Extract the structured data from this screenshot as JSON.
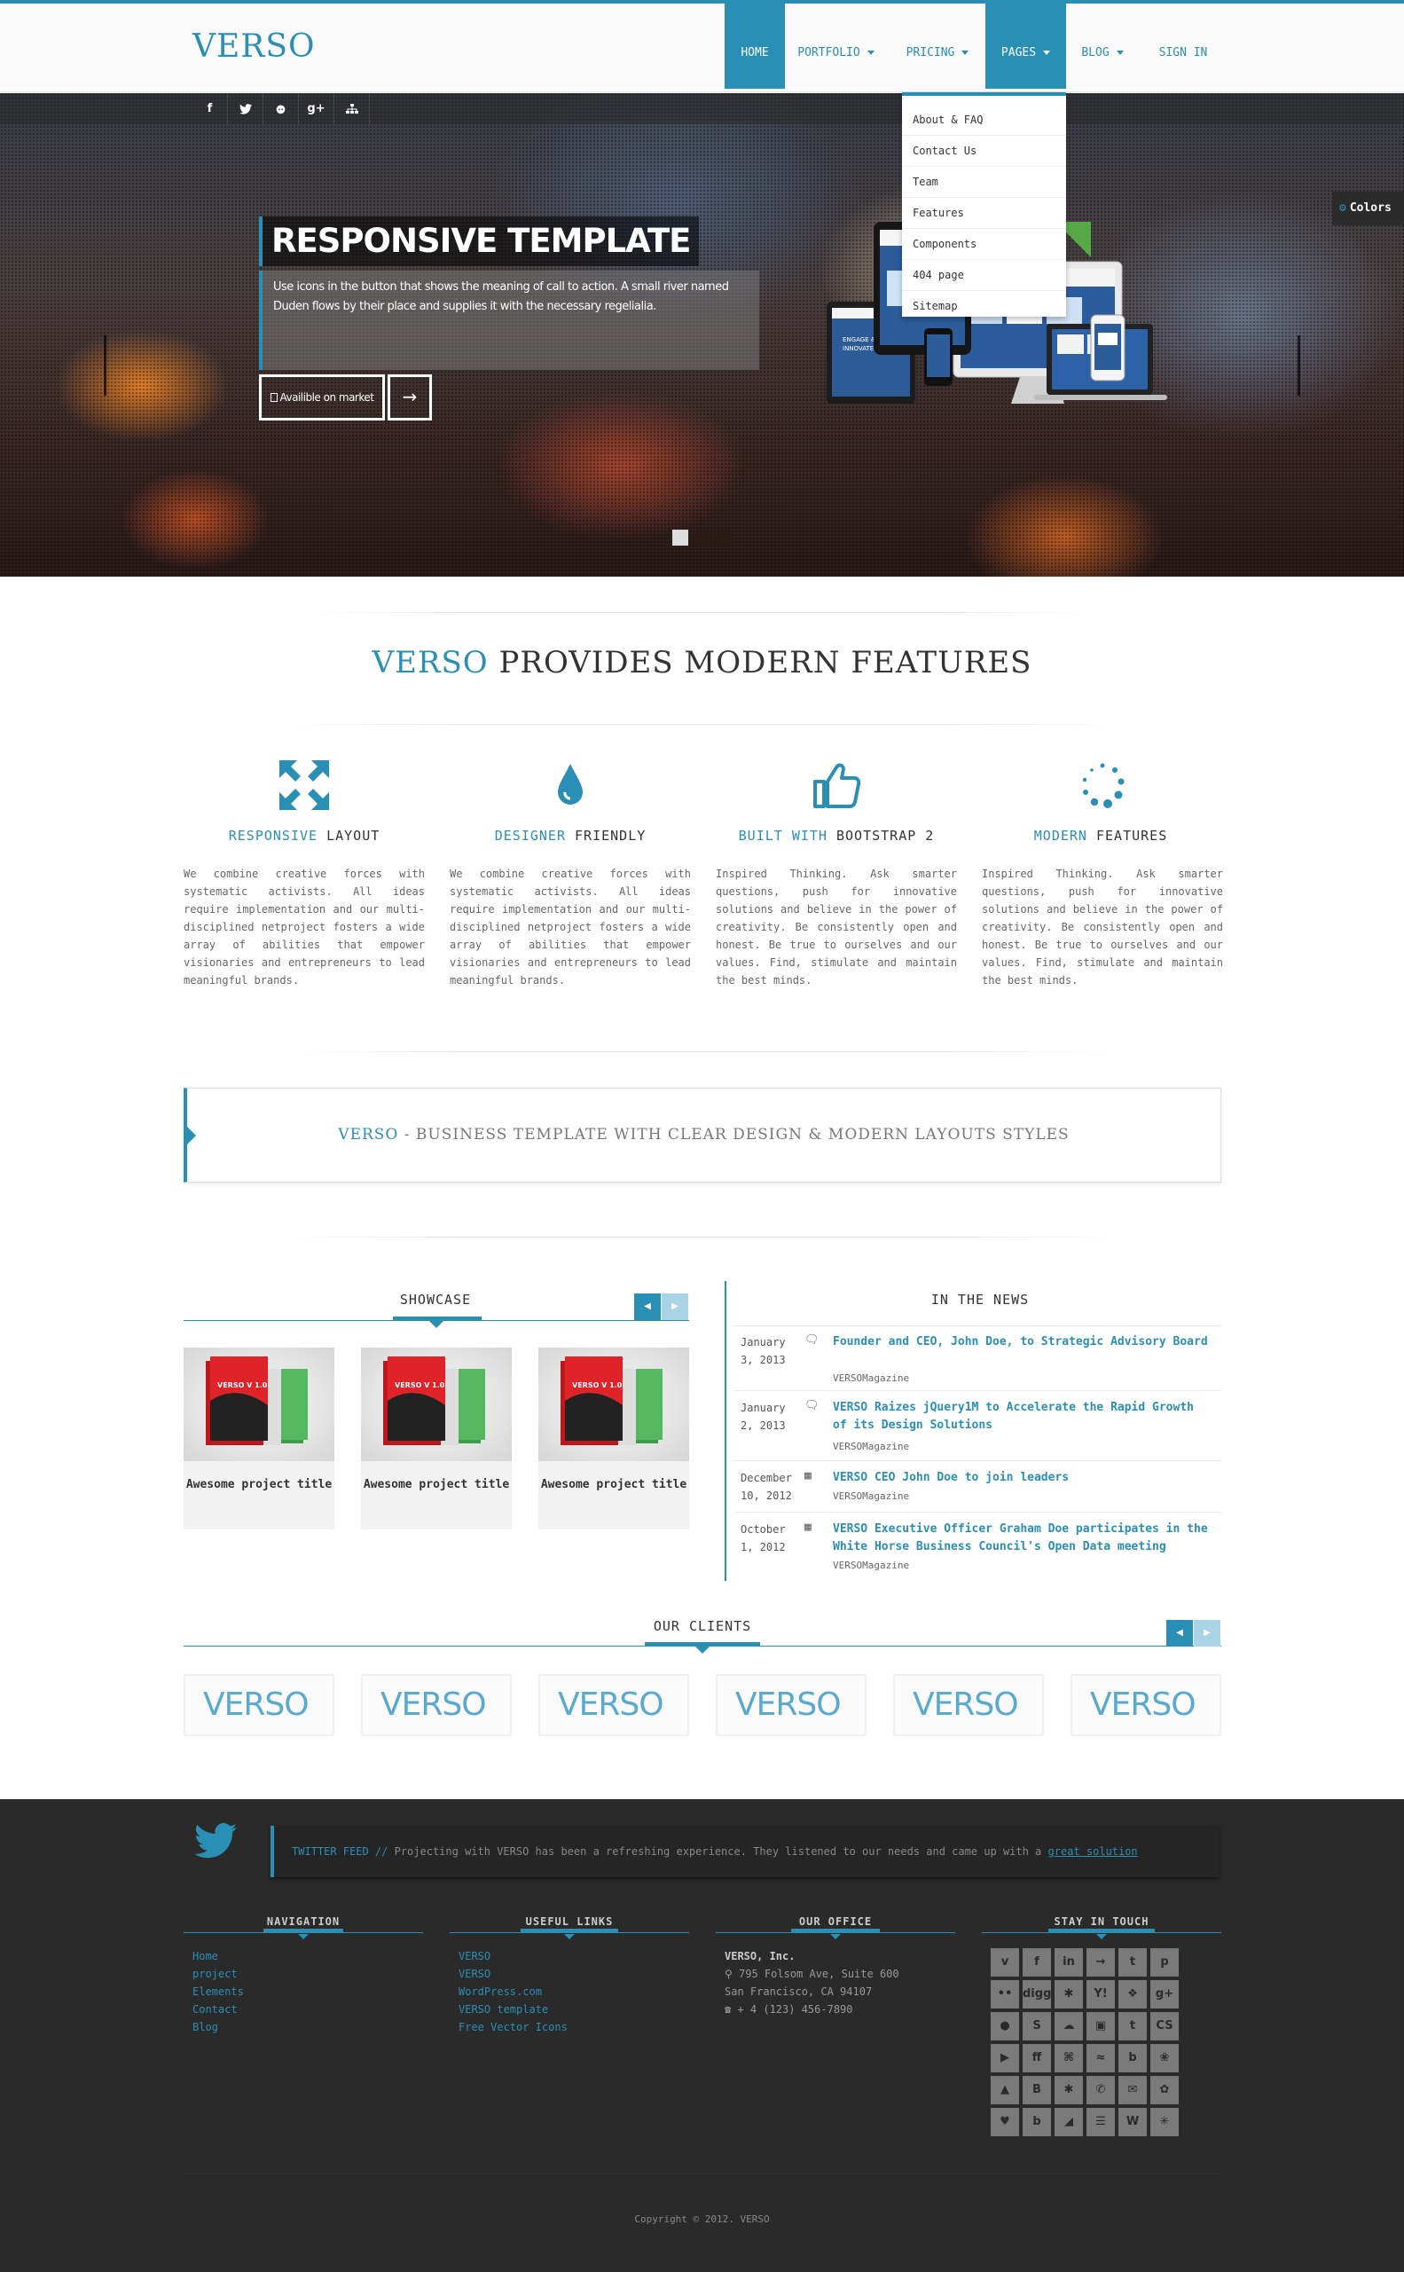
{
  "header": {
    "logo": "VERSO",
    "nav": [
      {
        "label": "HOME",
        "active": true,
        "dropdown": false
      },
      {
        "label": "PORTFOLIO",
        "active": false,
        "dropdown": true
      },
      {
        "label": "PRICING",
        "active": false,
        "dropdown": true
      },
      {
        "label": "PAGES",
        "active": false,
        "dropdown": true
      },
      {
        "label": "BLOG",
        "active": false,
        "dropdown": true
      },
      {
        "label": "SIGN IN",
        "active": false,
        "dropdown": false
      }
    ],
    "pages_dropdown": [
      "About & FAQ",
      "Contact Us",
      "Team",
      "Features",
      "Components",
      "404 page",
      "Sitemap"
    ]
  },
  "social_strip": [
    "f",
    "twitter-icon",
    "github-icon",
    "g+",
    "sitemap-icon"
  ],
  "colors_button": {
    "label": "Colors",
    "icon": "gears-icon"
  },
  "hero": {
    "title": "RESPONSIVE TEMPLATE",
    "text": "Use icons in the button that shows the meaning of call to action. A small river named Duden flows by their place and supplies it with the necessary regelialia.",
    "button_label": "Availible on market",
    "arrow": "→",
    "slides": 3,
    "active_slide": 0
  },
  "features": {
    "title_highlight": "VERSO",
    "title_rest": " PROVIDES MODERN FEATURES",
    "items": [
      {
        "icon": "expand-arrows-icon",
        "title_hl": "RESPONSIVE",
        "title_rest": " LAYOUT",
        "text": "We combine creative forces with systematic activists. All ideas require implementation and our multi-disciplined netproject fosters a wide array of abilities that empower visionaries and entrepreneurs to lead meaningful brands."
      },
      {
        "icon": "droplet-icon",
        "title_hl": "DESIGNER",
        "title_rest": " FRIENDLY",
        "text": "We combine creative forces with systematic activists. All ideas require implementation and our multi-disciplined netproject fosters a wide array of abilities that empower visionaries and entrepreneurs to lead meaningful brands."
      },
      {
        "icon": "thumbs-up-icon",
        "title_hl": "BUILT WITH",
        "title_rest": " BOOTSTRAP 2",
        "text": "Inspired Thinking. Ask smarter questions, push for innovative solutions and believe in the power of creativity. Be consistently open and honest. Be true to ourselves and our values. Find, stimulate and maintain the best minds."
      },
      {
        "icon": "spinner-icon",
        "title_hl": "MODERN",
        "title_rest": " FEATURES",
        "text": "Inspired Thinking. Ask smarter questions, push for innovative solutions and believe in the power of creativity. Be consistently open and honest. Be true to ourselves and our values. Find, stimulate and maintain the best minds."
      }
    ]
  },
  "banner": {
    "highlight": "VERSO",
    "rest": " - BUSINESS TEMPLATE WITH CLEAR DESIGN & MODERN LAYOUTS STYLES"
  },
  "showcase": {
    "title": "SHOWCASE",
    "items": [
      {
        "title": "Awesome project title",
        "box_label": "VERSO V 1.0"
      },
      {
        "title": "Awesome project title",
        "box_label": "VERSO V 1.0"
      },
      {
        "title": "Awesome project title",
        "box_label": "VERSO V 1.0"
      }
    ]
  },
  "news": {
    "title": "IN THE NEWS",
    "items": [
      {
        "date": "January 3, 2013",
        "icon": "comments-icon",
        "title": "Founder and CEO, John Doe, to Strategic Advisory Board",
        "source": "VERSOMagazine"
      },
      {
        "date": "January 2, 2013",
        "icon": "comments-icon",
        "title": "VERSO Raizes jQuery1M to Accelerate the Rapid Growth of its Design Solutions",
        "source": "VERSOMagazine"
      },
      {
        "date": "December 10, 2012",
        "icon": "calendar-icon",
        "title": "VERSO CEO John Doe to join leaders",
        "source": "VERSOMagazine"
      },
      {
        "date": "October 1, 2012",
        "icon": "calendar-icon",
        "title": "VERSO Executive Officer Graham Doe participates in the White Horse Business Council's Open Data meeting",
        "source": "VERSOMagazine"
      }
    ]
  },
  "clients": {
    "title": "OUR CLIENTS",
    "logos": [
      "VERSO",
      "VERSO",
      "VERSO",
      "VERSO",
      "VERSO",
      "VERSO"
    ]
  },
  "footer": {
    "twitter": {
      "label": "TWITTER FEED //",
      "text": " Projecting with VERSO has been a refreshing experience. They listened to our needs and came up with a ",
      "link": "great solution"
    },
    "navigation": {
      "title": "NAVIGATION",
      "links": [
        "Home",
        "project",
        "Elements",
        "Contact",
        "Blog"
      ]
    },
    "useful_links": {
      "title": "USEFUL LINKS",
      "links": [
        "VERSO",
        "VERSO",
        "WordPress.com",
        "VERSO template",
        "Free Vector Icons"
      ]
    },
    "office": {
      "title": "OUR OFFICE",
      "company": "VERSO, Inc.",
      "address1": "795 Folsom Ave, Suite 600",
      "address2": "San Francisco, CA 94107",
      "phone": "+ 4 (123) 456-7890"
    },
    "stay_in_touch": {
      "title": "STAY IN TOUCH",
      "icons": [
        "v",
        "f",
        "in",
        "→",
        "t",
        "p",
        "••",
        "digg",
        "✱",
        "Y!",
        "❖",
        "g+",
        "●",
        "S",
        "☁",
        "▣",
        "t",
        "CS",
        "▶",
        "ff",
        "⌘",
        "≈",
        "b",
        "❀",
        "▲",
        "B",
        "✱",
        "✆",
        "✉",
        "✿",
        "♥",
        "b",
        "◢",
        "☰",
        "W",
        "✳"
      ]
    },
    "copyright": "Copyright © 2012. VERSO"
  },
  "colors": {
    "accent": "#2a8fb5",
    "footer_bg": "#2a2a2a"
  }
}
